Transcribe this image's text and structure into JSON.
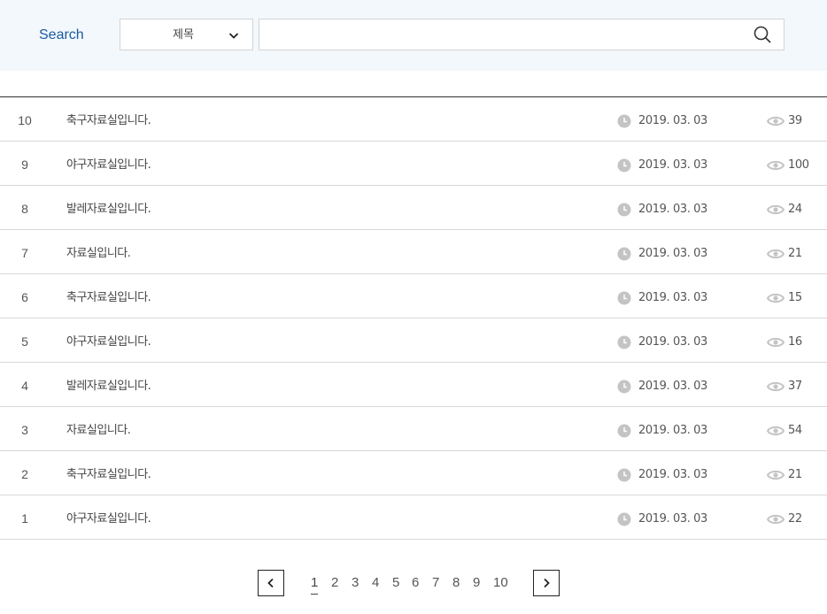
{
  "search": {
    "label": "Search",
    "select_value": "제목",
    "input_value": "",
    "input_placeholder": "",
    "icon": "search-icon"
  },
  "rows": [
    {
      "num": "10",
      "title": "축구자료실입니다.",
      "date": "2019. 03. 03",
      "views": "39"
    },
    {
      "num": "9",
      "title": "야구자료실입니다.",
      "date": "2019. 03. 03",
      "views": "100"
    },
    {
      "num": "8",
      "title": "발레자료실입니다.",
      "date": "2019. 03. 03",
      "views": "24"
    },
    {
      "num": "7",
      "title": "자료실입니다.",
      "date": "2019. 03. 03",
      "views": "21"
    },
    {
      "num": "6",
      "title": "축구자료실입니다.",
      "date": "2019. 03. 03",
      "views": "15"
    },
    {
      "num": "5",
      "title": "야구자료실입니다.",
      "date": "2019. 03. 03",
      "views": "16"
    },
    {
      "num": "4",
      "title": "발레자료실입니다.",
      "date": "2019. 03. 03",
      "views": "37"
    },
    {
      "num": "3",
      "title": "자료실입니다.",
      "date": "2019. 03. 03",
      "views": "54"
    },
    {
      "num": "2",
      "title": "축구자료실입니다.",
      "date": "2019. 03. 03",
      "views": "21"
    },
    {
      "num": "1",
      "title": "야구자료실입니다.",
      "date": "2019. 03. 03",
      "views": "22"
    }
  ],
  "pagination": {
    "pages": [
      "1",
      "2",
      "3",
      "4",
      "5",
      "6",
      "7",
      "8",
      "9",
      "10"
    ],
    "current": "1"
  },
  "colors": {
    "search_bg": "#f3f8fd",
    "accent": "#1b5aa0",
    "icon_gray": "#c4c4c4"
  }
}
